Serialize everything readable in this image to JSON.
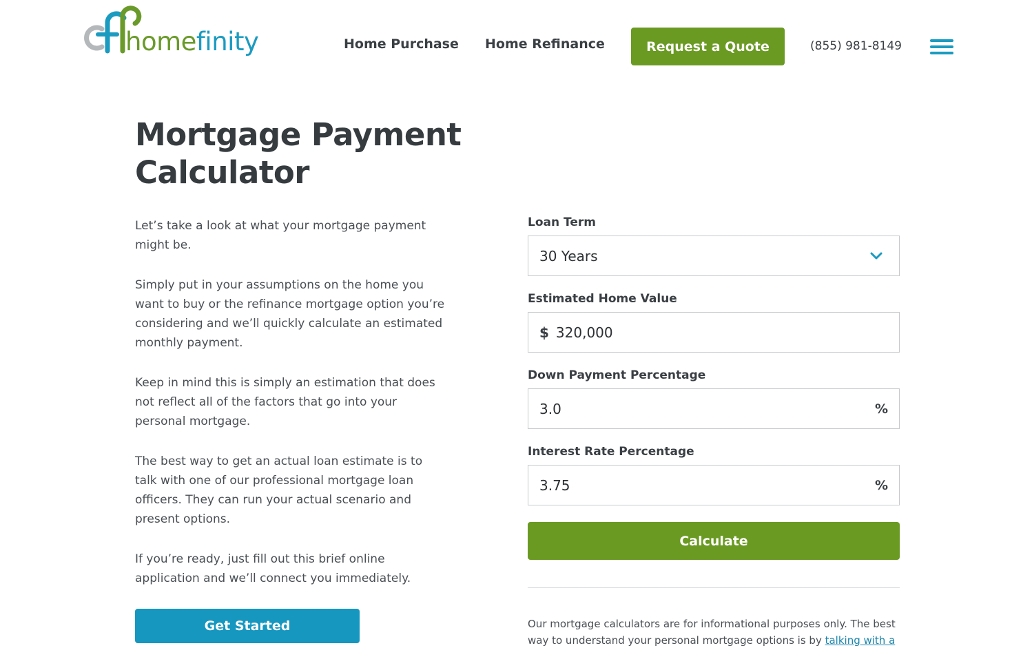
{
  "header": {
    "logo": {
      "home": "home",
      "finity": "finity"
    },
    "nav": [
      "Home Purchase",
      "Home Refinance"
    ],
    "quote_button": "Request a Quote",
    "phone": "(855) 981-8149"
  },
  "main": {
    "title_line1": "Mortgage Payment",
    "title_line2": "Calculator",
    "paragraphs": [
      "Let’s take a look at what your mortgage payment might be.",
      "Simply put in your assumptions on the home you want to buy or the refinance mortgage option you’re considering and we’ll quickly calculate an estimated monthly payment.",
      "Keep in mind this is simply an estimation that does not reflect all of the factors that go into your personal mortgage.",
      "The best way to get an actual loan estimate is to talk with one of our professional mortgage loan officers. They can run your actual scenario and present options.",
      "If you’re ready, just fill out this brief online application and we’ll connect you immediately."
    ],
    "get_started": "Get Started"
  },
  "form": {
    "loan_term": {
      "label": "Loan Term",
      "value": "30 Years"
    },
    "home_value": {
      "label": "Estimated Home Value",
      "prefix": "$",
      "value": "320,000"
    },
    "down_payment": {
      "label": "Down Payment Percentage",
      "value": "3.0",
      "suffix": "%"
    },
    "interest_rate": {
      "label": "Interest Rate Percentage",
      "value": "3.75",
      "suffix": "%"
    },
    "calculate": "Calculate"
  },
  "disclaimer": {
    "text": "Our mortgage calculators are for informational purposes only. The best way to understand your personal mortgage options is by ",
    "link": "talking with a"
  },
  "colors": {
    "green": "#6a9a22",
    "blue": "#1597c0",
    "text": "#3a3f44"
  }
}
